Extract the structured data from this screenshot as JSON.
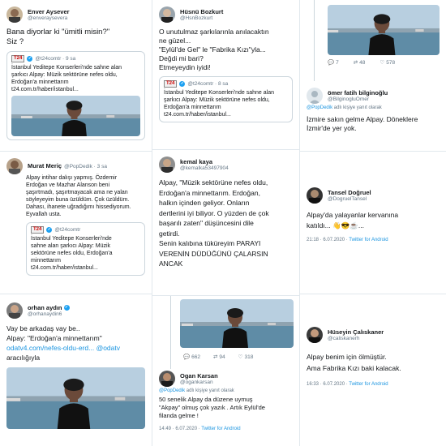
{
  "tweets": {
    "t1": {
      "name": "Enver Aysever",
      "handle": "@enveraysevera",
      "text_lines": [
        "Bana diyorlar ki \"ümitli misin?\"",
        "Siz ?"
      ],
      "quote_source": "T24",
      "quote_handle": "@t24comtr · 9 sa",
      "quote_lines": [
        "İstanbul Yeditepe Konserleri'nde sahne alan",
        "şarkıcı Alpay: Müzik sektörüne nefes oldu,",
        "Erdoğan'a minnettarım",
        "t24.com.tr/haber/istanbul..."
      ]
    },
    "t2": {
      "name": "Hüsnü Bozkurt",
      "handle": "@HsnBozkurt",
      "text_lines": [
        "O unutulmaz şarkılarınla anılacaktın",
        "ne güzel...",
        "\"Eylül'de Gel\" le \"Fabrika Kızı\"yla...",
        "Değdi mi bari?",
        "Etmeyeydin iyidi!"
      ],
      "quote_source": "T24",
      "quote_handle": "@t24comtr · 8 sa",
      "quote_lines": [
        "İstanbul Yeditepe Konserleri'nde sahne alan",
        "şarkıcı Alpay: Müzik sektörüne nefes oldu,",
        "Erdoğan'a minnettarım",
        "t24.com.tr/haber/istanbul..."
      ]
    },
    "t3": {
      "actions": {
        "replies": "7",
        "retweets": "48",
        "likes": "578"
      },
      "name": "ömer fatih bilginoğlu",
      "handle": "@BilginogluOmer",
      "replying_prefix": "@PopDedik",
      "replying_suffix": "adlı kişiye yanıt olarak",
      "text_lines": [
        "İzmire sakın gelme Alpay. Döneklere",
        "İzmir'de yer yok."
      ]
    },
    "t4": {
      "name": "Murat Meriç",
      "handle": "@PopDedik · 3 sa",
      "text_lines": [
        "Alpay intihar dalışı yapmış. Özdemir",
        "Erdoğan ve Mazhar Alanson beni",
        "şaşırtmadı, şaşırtmayacak ama ne yalan",
        "söyleyeyim buna üzüldüm. Çok üzüldüm.",
        "Dahası, ihanete uğradığımı hissediyorum.",
        "Eyvallah usta."
      ],
      "quote_source": "T24",
      "quote_handle": "@t24comtr",
      "quote_lines": [
        "İstanbul Yeditepe Konserleri'nde",
        "sahne alan şarkıcı Alpay: Müzik",
        "sektörüne nefes oldu, Erdoğan'a",
        "minnettarım",
        "t24.com.tr/haber/istanbul..."
      ]
    },
    "t5": {
      "name": "kemal kaya",
      "handle": "@kemalka53497904",
      "text_lines": [
        "Alpay, \"Müzik sektörüne nefes oldu,",
        "Erdoğan'a minnettarım. Erdoğan,",
        "halkın içinden geliyor. Onların",
        "dertlerini iyi biliyor. O yüzden de çok",
        "başarılı zaten\" düşüncesini dile",
        "getirdi.",
        "Senin kalıbına tüküreyim PARAYI",
        "VERENİN DÜDÜĞÜNÜ ÇALARSIN",
        "ANCAK"
      ]
    },
    "t6": {
      "name": "Tansel Doğruel",
      "handle": "@DogruelTansel",
      "text_lines": [
        "Alpay'da yalayanlar kervanına",
        "katıldı... 👋😎☕..."
      ],
      "meta_time": "21:18 · 6.07.2020 ·",
      "meta_source": "Twitter for Android"
    },
    "t7": {
      "name": "orhan aydın",
      "handle": "@orhanaydin6",
      "text_lines": [
        "Vay be arkadaş vay be..",
        "Alpay: \"Erdoğan'a minnettarım\""
      ],
      "link_line": "odatv4.com/nefes-oldu-erd...",
      "mention": "@odatv",
      "tail": "aracılığıyla"
    },
    "t8": {
      "actions": {
        "replies": "662",
        "retweets": "94",
        "likes": "318"
      },
      "name": "Ogan Karsan",
      "handle": "@ogankarsan",
      "replying_prefix": "@PopDedik",
      "replying_suffix": "adlı kişiye yanıt olarak",
      "text_lines": [
        "50 senelik Alpay da düzene uymuş",
        "\"Akpay\" olmuş çok yazık . Artık Eylül'de",
        "filanda gelme !"
      ],
      "meta_time": "14:49 · 6.07.2020 ·",
      "meta_source": "Twitter for Android"
    },
    "t9": {
      "name": "Hüseyin Çalıskaner",
      "handle": "@caliskanerh",
      "text_lines": [
        "Alpay benim için ölmüştür.",
        "Ama Fabrika Kızı baki kalacak."
      ],
      "meta_time": "16:33 · 6.07.2020 ·",
      "meta_source": "Twitter for Android"
    }
  },
  "colors": {
    "link": "#1b95e0",
    "verified": "#1da1f2",
    "muted": "#657786",
    "border": "#ccd6dd"
  }
}
